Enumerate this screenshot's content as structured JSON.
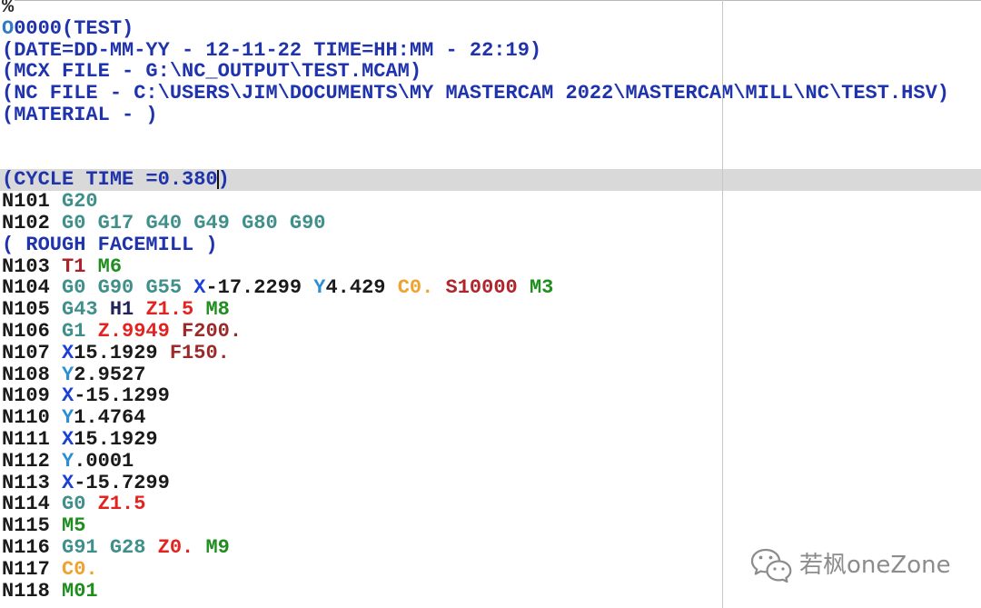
{
  "editor": {
    "current_line_bg": "#d9d9d9",
    "caret_color": "#111111",
    "guide_color": "#c6c6c6",
    "lines": [
      {
        "words": [
          [
            {
              "t": "%",
              "c": "#2b2b2b"
            }
          ]
        ]
      },
      {
        "words": [
          [
            {
              "t": "O",
              "c": "#2f7cc6"
            },
            {
              "t": "0000",
              "c": "#1f33ad"
            },
            {
              "t": "(TEST)",
              "c": "#1f33ad"
            }
          ]
        ]
      },
      {
        "words": [
          [
            {
              "t": "(DATE=DD-MM-YY - 12-11-22 TIME=HH:MM - 22:19)",
              "c": "#1f33ad"
            }
          ]
        ]
      },
      {
        "words": [
          [
            {
              "t": "(MCX FILE - G:\\NC_OUTPUT\\TEST.MCAM)",
              "c": "#1f33ad"
            }
          ]
        ]
      },
      {
        "words": [
          [
            {
              "t": "(NC FILE - C:\\USERS\\JIM\\DOCUMENTS\\MY MASTERCAM 2022\\MASTERCAM\\MILL\\NC\\TEST.HSV)",
              "c": "#1f33ad"
            }
          ]
        ]
      },
      {
        "words": [
          [
            {
              "t": "(MATERIAL - )",
              "c": "#1f33ad"
            }
          ]
        ]
      },
      {
        "words": []
      },
      {
        "words": []
      },
      {
        "current": true,
        "words": [
          [
            {
              "t": "(CYCLE TIME =0.380",
              "c": "#1f33ad"
            },
            {
              "caret": true
            },
            {
              "t": ")",
              "c": "#1f33ad"
            }
          ]
        ]
      },
      {
        "words": [
          [
            {
              "t": "N101",
              "c": "#1a1a1a"
            }
          ],
          [
            {
              "t": "G20",
              "c": "#3f8f8b"
            }
          ]
        ]
      },
      {
        "words": [
          [
            {
              "t": "N102",
              "c": "#1a1a1a"
            }
          ],
          [
            {
              "t": "G0",
              "c": "#3f8f8b"
            }
          ],
          [
            {
              "t": "G17",
              "c": "#3f8f8b"
            }
          ],
          [
            {
              "t": "G40",
              "c": "#3f8f8b"
            }
          ],
          [
            {
              "t": "G49",
              "c": "#3f8f8b"
            }
          ],
          [
            {
              "t": "G80",
              "c": "#3f8f8b"
            }
          ],
          [
            {
              "t": "G90",
              "c": "#3f8f8b"
            }
          ]
        ]
      },
      {
        "words": [
          [
            {
              "t": "( ROUGH FACEMILL )",
              "c": "#1f33ad"
            }
          ]
        ]
      },
      {
        "words": [
          [
            {
              "t": "N103",
              "c": "#1a1a1a"
            }
          ],
          [
            {
              "t": "T1",
              "c": "#a8242a"
            }
          ],
          [
            {
              "t": "M6",
              "c": "#1f8e1f"
            }
          ]
        ]
      },
      {
        "words": [
          [
            {
              "t": "N104",
              "c": "#1a1a1a"
            }
          ],
          [
            {
              "t": "G0",
              "c": "#3f8f8b"
            }
          ],
          [
            {
              "t": "G90",
              "c": "#3f8f8b"
            }
          ],
          [
            {
              "t": "G55",
              "c": "#3f8f8b"
            }
          ],
          [
            {
              "t": "X",
              "c": "#1b3fd8"
            },
            {
              "t": "-17.2299",
              "c": "#1a1a1a"
            }
          ],
          [
            {
              "t": "Y",
              "c": "#2b8fd2"
            },
            {
              "t": "4.429",
              "c": "#1a1a1a"
            }
          ],
          [
            {
              "t": "C0.",
              "c": "#f0a22e"
            }
          ],
          [
            {
              "t": "S10000",
              "c": "#b0242c"
            }
          ],
          [
            {
              "t": "M3",
              "c": "#1f8e1f"
            }
          ]
        ]
      },
      {
        "words": [
          [
            {
              "t": "N105",
              "c": "#1a1a1a"
            }
          ],
          [
            {
              "t": "G43",
              "c": "#3f8f8b"
            }
          ],
          [
            {
              "t": "H1",
              "c": "#23235a"
            }
          ],
          [
            {
              "t": "Z1.5",
              "c": "#e2231f"
            }
          ],
          [
            {
              "t": "M8",
              "c": "#1f8e1f"
            }
          ]
        ]
      },
      {
        "words": [
          [
            {
              "t": "N106",
              "c": "#1a1a1a"
            }
          ],
          [
            {
              "t": "G1",
              "c": "#3f8f8b"
            }
          ],
          [
            {
              "t": "Z.9949",
              "c": "#e2231f"
            }
          ],
          [
            {
              "t": "F200.",
              "c": "#9c2a2a"
            }
          ]
        ]
      },
      {
        "words": [
          [
            {
              "t": "N107",
              "c": "#1a1a1a"
            }
          ],
          [
            {
              "t": "X",
              "c": "#1b3fd8"
            },
            {
              "t": "15.1929",
              "c": "#1a1a1a"
            }
          ],
          [
            {
              "t": "F150.",
              "c": "#9c2a2a"
            }
          ]
        ]
      },
      {
        "words": [
          [
            {
              "t": "N108",
              "c": "#1a1a1a"
            }
          ],
          [
            {
              "t": "Y",
              "c": "#2b8fd2"
            },
            {
              "t": "2.9527",
              "c": "#1a1a1a"
            }
          ]
        ]
      },
      {
        "words": [
          [
            {
              "t": "N109",
              "c": "#1a1a1a"
            }
          ],
          [
            {
              "t": "X",
              "c": "#1b3fd8"
            },
            {
              "t": "-15.1299",
              "c": "#1a1a1a"
            }
          ]
        ]
      },
      {
        "words": [
          [
            {
              "t": "N110",
              "c": "#1a1a1a"
            }
          ],
          [
            {
              "t": "Y",
              "c": "#2b8fd2"
            },
            {
              "t": "1.4764",
              "c": "#1a1a1a"
            }
          ]
        ]
      },
      {
        "words": [
          [
            {
              "t": "N111",
              "c": "#1a1a1a"
            }
          ],
          [
            {
              "t": "X",
              "c": "#1b3fd8"
            },
            {
              "t": "15.1929",
              "c": "#1a1a1a"
            }
          ]
        ]
      },
      {
        "words": [
          [
            {
              "t": "N112",
              "c": "#1a1a1a"
            }
          ],
          [
            {
              "t": "Y",
              "c": "#2b8fd2"
            },
            {
              "t": ".0001",
              "c": "#1a1a1a"
            }
          ]
        ]
      },
      {
        "words": [
          [
            {
              "t": "N113",
              "c": "#1a1a1a"
            }
          ],
          [
            {
              "t": "X",
              "c": "#1b3fd8"
            },
            {
              "t": "-15.7299",
              "c": "#1a1a1a"
            }
          ]
        ]
      },
      {
        "words": [
          [
            {
              "t": "N114",
              "c": "#1a1a1a"
            }
          ],
          [
            {
              "t": "G0",
              "c": "#3f8f8b"
            }
          ],
          [
            {
              "t": "Z1.5",
              "c": "#e2231f"
            }
          ]
        ]
      },
      {
        "words": [
          [
            {
              "t": "N115",
              "c": "#1a1a1a"
            }
          ],
          [
            {
              "t": "M5",
              "c": "#1f8e1f"
            }
          ]
        ]
      },
      {
        "words": [
          [
            {
              "t": "N116",
              "c": "#1a1a1a"
            }
          ],
          [
            {
              "t": "G91",
              "c": "#3f8f8b"
            }
          ],
          [
            {
              "t": "G28",
              "c": "#3f8f8b"
            }
          ],
          [
            {
              "t": "Z0.",
              "c": "#e2231f"
            }
          ],
          [
            {
              "t": "M9",
              "c": "#1f8e1f"
            }
          ]
        ]
      },
      {
        "words": [
          [
            {
              "t": "N117",
              "c": "#1a1a1a"
            }
          ],
          [
            {
              "t": "C0.",
              "c": "#f0a22e"
            }
          ]
        ]
      },
      {
        "words": [
          [
            {
              "t": "N118",
              "c": "#1a1a1a"
            }
          ],
          [
            {
              "t": "M01",
              "c": "#1f8e1f"
            }
          ]
        ]
      }
    ]
  },
  "watermark": {
    "icon": "wechat-icon",
    "text": "若枫oneZone",
    "color": "#8c8c8c"
  }
}
